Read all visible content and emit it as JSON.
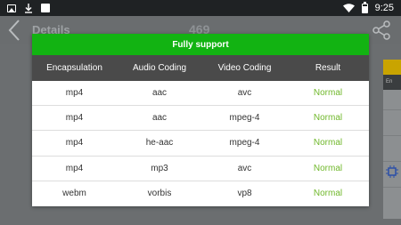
{
  "status_bar": {
    "time": "9:25"
  },
  "app_bar": {
    "title": "Details",
    "number": "469"
  },
  "dialog": {
    "title": "Fully support",
    "columns": [
      "Encapsulation",
      "Audio Coding",
      "Video Coding",
      "Result"
    ],
    "rows": [
      {
        "encapsulation": "mp4",
        "audio": "aac",
        "video": "avc",
        "result": "Normal"
      },
      {
        "encapsulation": "mp4",
        "audio": "aac",
        "video": "mpeg-4",
        "result": "Normal"
      },
      {
        "encapsulation": "mp4",
        "audio": "he-aac",
        "video": "mpeg-4",
        "result": "Normal"
      },
      {
        "encapsulation": "mp4",
        "audio": "mp3",
        "video": "avc",
        "result": "Normal"
      },
      {
        "encapsulation": "webm",
        "audio": "vorbis",
        "video": "vp8",
        "result": "Normal"
      }
    ]
  },
  "right_peek": {
    "label": "En"
  },
  "colors": {
    "accent_green": "#12b312",
    "result_green": "#70b82b",
    "header_dark": "#4a4a4a"
  }
}
